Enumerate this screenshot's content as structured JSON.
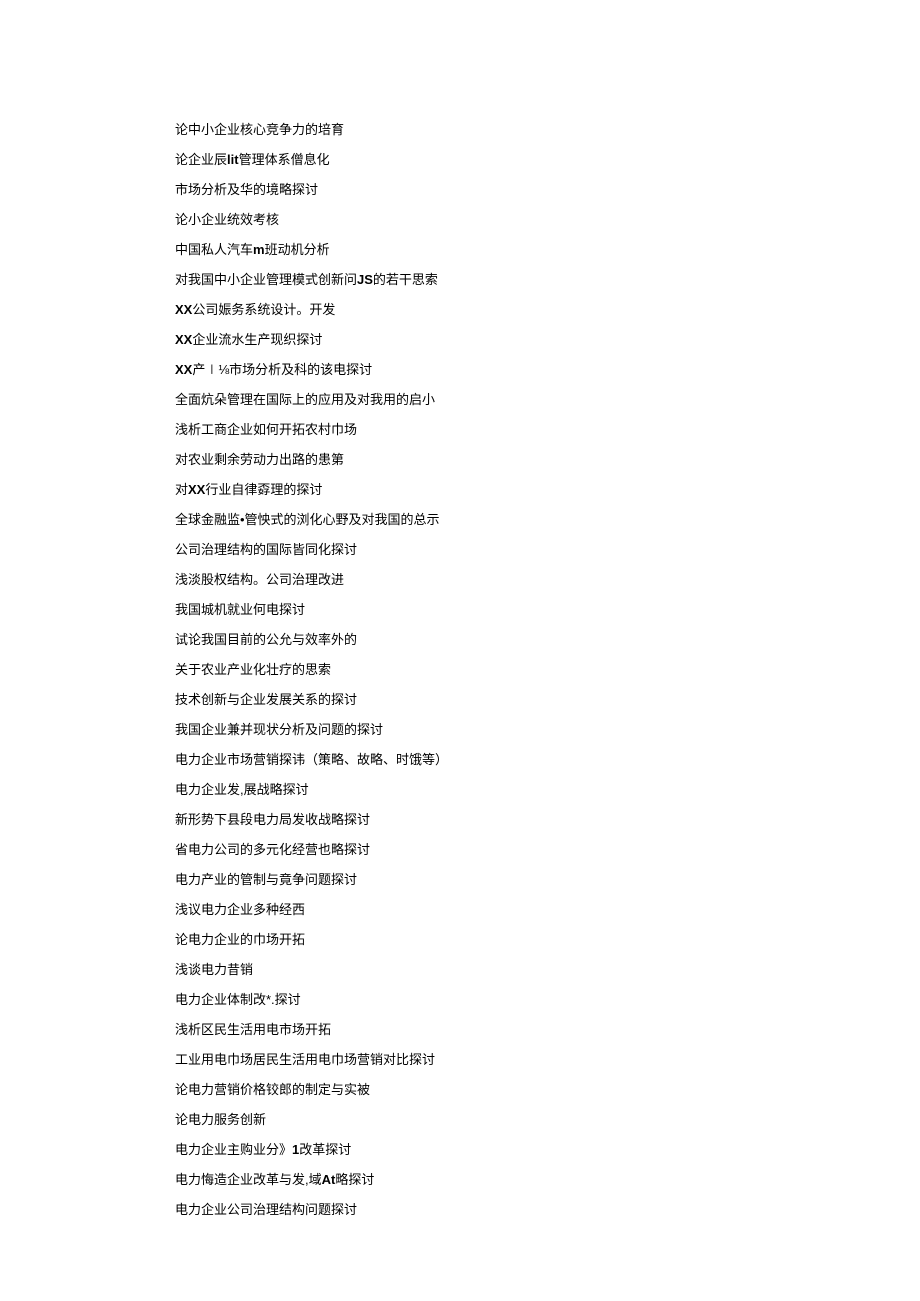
{
  "items": [
    {
      "segments": [
        {
          "text": "论中小企业核心竞争力的培育",
          "bold": false
        }
      ]
    },
    {
      "segments": [
        {
          "text": "论企业辰",
          "bold": false
        },
        {
          "text": "lit",
          "bold": true
        },
        {
          "text": "管理体系僧息化",
          "bold": false
        }
      ]
    },
    {
      "segments": [
        {
          "text": "市场分析及华的境略探讨",
          "bold": false
        }
      ]
    },
    {
      "segments": [
        {
          "text": "论小企业统效考核",
          "bold": false
        }
      ]
    },
    {
      "segments": [
        {
          "text": "中国私人汽车",
          "bold": false
        },
        {
          "text": "m",
          "bold": true
        },
        {
          "text": "班动机分析",
          "bold": false
        }
      ]
    },
    {
      "segments": [
        {
          "text": "对我国中小企业管理模式创新问",
          "bold": false
        },
        {
          "text": "JS",
          "bold": true
        },
        {
          "text": "的若干思索",
          "bold": false
        }
      ]
    },
    {
      "segments": [
        {
          "text": "XX",
          "bold": true
        },
        {
          "text": "公司娠务系统设计。开发",
          "bold": false
        }
      ]
    },
    {
      "segments": [
        {
          "text": "XX",
          "bold": true
        },
        {
          "text": "企业流水生产现织探讨",
          "bold": false
        }
      ]
    },
    {
      "segments": [
        {
          "text": "XX",
          "bold": true
        },
        {
          "text": "产∣⅛市场分析及科的该电探讨",
          "bold": false
        }
      ]
    },
    {
      "segments": [
        {
          "text": "全面炕朵管理在国际上的应用及对我用的启小",
          "bold": false
        }
      ]
    },
    {
      "segments": [
        {
          "text": "浅析工商企业如何开拓农村巾场",
          "bold": false
        }
      ]
    },
    {
      "segments": [
        {
          "text": "对农业剩余劳动力出路的患第",
          "bold": false
        }
      ]
    },
    {
      "segments": [
        {
          "text": "对",
          "bold": false
        },
        {
          "text": "XX",
          "bold": true
        },
        {
          "text": "行业自律孬理的探讨",
          "bold": false
        }
      ]
    },
    {
      "segments": [
        {
          "text": "全球金融监•管怏式的浏化心野及对我国的总示",
          "bold": false
        }
      ]
    },
    {
      "segments": [
        {
          "text": "公司治理结构的国际皆同化探讨",
          "bold": false
        }
      ]
    },
    {
      "segments": [
        {
          "text": "浅淡股权结构。公司治理改进",
          "bold": false
        }
      ]
    },
    {
      "segments": [
        {
          "text": "我国城机就业何电探讨",
          "bold": false
        }
      ]
    },
    {
      "segments": [
        {
          "text": "试论我国目前的公允与效率外的",
          "bold": false
        }
      ]
    },
    {
      "segments": [
        {
          "text": "关于农业产业化壮疗的思索",
          "bold": false
        }
      ]
    },
    {
      "segments": [
        {
          "text": "技术创新与企业发展关系的探讨",
          "bold": false
        }
      ]
    },
    {
      "segments": [
        {
          "text": "我国企业兼并现状分析及问题的探讨",
          "bold": false
        }
      ]
    },
    {
      "segments": [
        {
          "text": "电力企业市场营销探讳（策略、故略、时饿等）",
          "bold": false
        }
      ]
    },
    {
      "segments": [
        {
          "text": "电力企业发,展战略探讨",
          "bold": false
        }
      ]
    },
    {
      "segments": [
        {
          "text": "新形势下县段电力局发收战略探讨",
          "bold": false
        }
      ]
    },
    {
      "segments": [
        {
          "text": "省电力公司的多元化经营也略探讨",
          "bold": false
        }
      ]
    },
    {
      "segments": [
        {
          "text": "电力产业的管制与竟争问题探讨",
          "bold": false
        }
      ]
    },
    {
      "segments": [
        {
          "text": "浅议电力企业多种经西",
          "bold": false
        }
      ]
    },
    {
      "segments": [
        {
          "text": "论电力企业的巾场开拓",
          "bold": false
        }
      ]
    },
    {
      "segments": [
        {
          "text": "浅谈电力昔销",
          "bold": false
        }
      ]
    },
    {
      "segments": [
        {
          "text": "电力企业体制改*.探讨",
          "bold": false
        }
      ]
    },
    {
      "segments": [
        {
          "text": "浅析区民生活用电市场开拓",
          "bold": false
        }
      ]
    },
    {
      "segments": [
        {
          "text": "工业用电巾场居民生活用电巾场营销对比探讨",
          "bold": false
        }
      ]
    },
    {
      "segments": [
        {
          "text": "论电力营销价格铰郎的制定与实被",
          "bold": false
        }
      ]
    },
    {
      "segments": [
        {
          "text": "论电力服务创新",
          "bold": false
        }
      ]
    },
    {
      "segments": [
        {
          "text": "电力企业主购业分》",
          "bold": false
        },
        {
          "text": "1",
          "bold": true
        },
        {
          "text": "改革探讨",
          "bold": false
        }
      ]
    },
    {
      "segments": [
        {
          "text": "电力悔造企业改革与发,域",
          "bold": false
        },
        {
          "text": "At",
          "bold": true
        },
        {
          "text": "略探讨",
          "bold": false
        }
      ]
    },
    {
      "segments": [
        {
          "text": "电力企业公司治理结构问题探讨",
          "bold": false
        }
      ]
    }
  ]
}
